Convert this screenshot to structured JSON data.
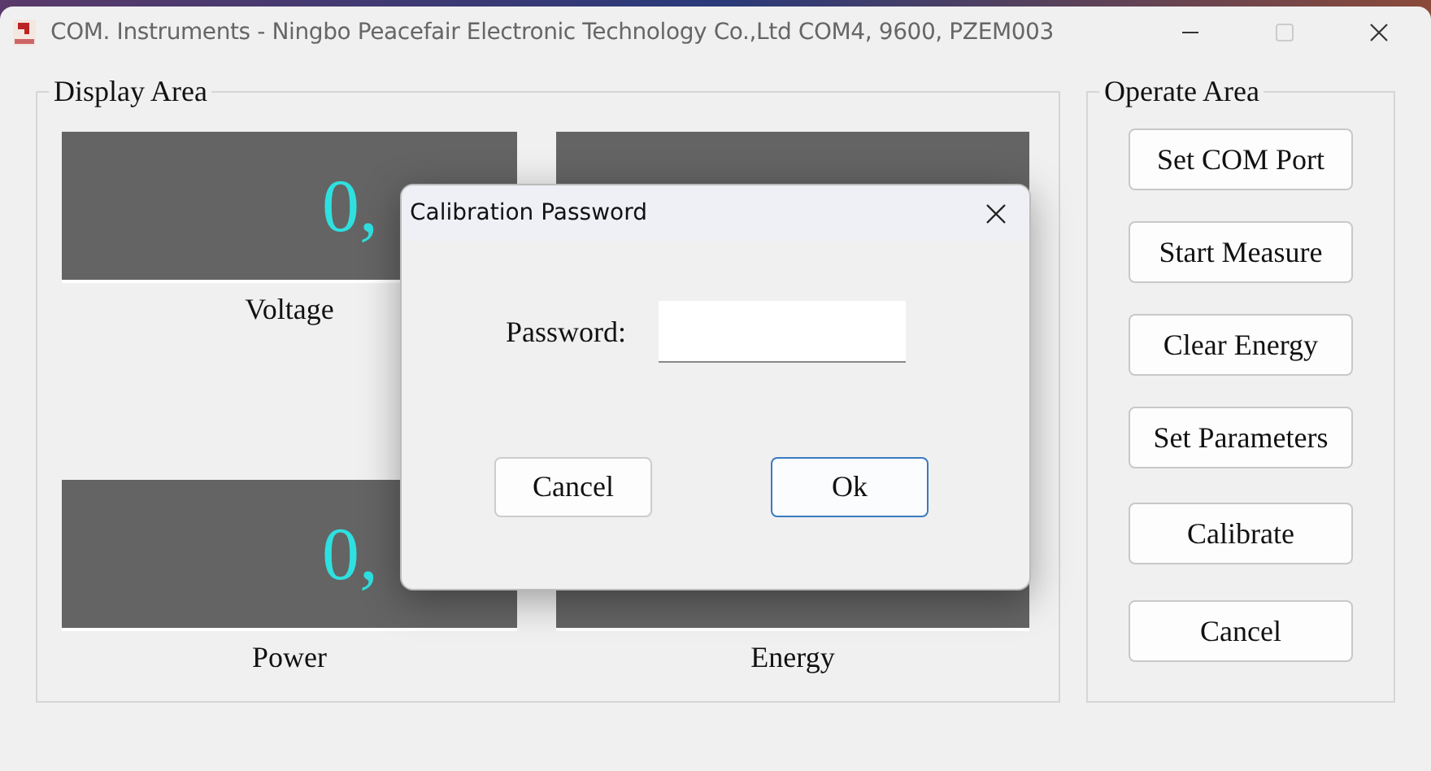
{
  "window": {
    "title": "COM. Instruments - Ningbo Peacefair Electronic Technology Co.,Ltd  COM4, 9600, PZEM003"
  },
  "display_area": {
    "title": "Display Area",
    "meters": [
      {
        "kind": "meter",
        "value": "0,",
        "label": "Voltage"
      },
      {
        "kind": "meter"
      },
      {
        "kind": "meter",
        "value": "0,",
        "label": "Power"
      },
      {
        "kind": "meter",
        "label": "Energy"
      }
    ]
  },
  "operate_area": {
    "title": "Operate Area",
    "buttons": [
      "Set COM Port",
      "Start Measure",
      "Clear Energy",
      "Set Parameters",
      "Calibrate",
      "Cancel"
    ]
  },
  "dialog": {
    "title": "Calibration Password",
    "field_label": "Password:",
    "buttons": [
      {
        "label": "Cancel",
        "default": false
      },
      {
        "label": "Ok",
        "default": true
      }
    ]
  }
}
